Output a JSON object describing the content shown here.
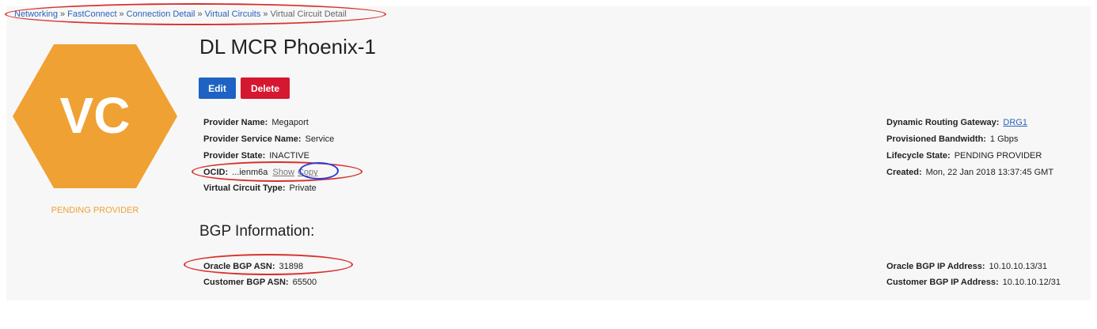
{
  "breadcrumb": {
    "items": [
      {
        "label": "Networking",
        "link": true
      },
      {
        "label": "FastConnect",
        "link": true
      },
      {
        "label": "Connection Detail",
        "link": true
      },
      {
        "label": "Virtual Circuits",
        "link": true
      },
      {
        "label": "Virtual Circuit Detail",
        "link": false
      }
    ],
    "separator": "»"
  },
  "resource_icon": {
    "abbr": "VC",
    "color": "#f0a133",
    "state": "PENDING PROVIDER"
  },
  "header": {
    "title": "DL MCR Phoenix-1",
    "edit_label": "Edit",
    "delete_label": "Delete"
  },
  "details_left": {
    "provider_name": {
      "label": "Provider Name:",
      "value": "Megaport"
    },
    "provider_service_name": {
      "label": "Provider Service Name:",
      "value": "Service"
    },
    "provider_state": {
      "label": "Provider State:",
      "value": "INACTIVE"
    },
    "ocid": {
      "label": "OCID:",
      "value": "...ienm6a",
      "show_label": "Show",
      "copy_label": "Copy"
    },
    "virtual_circuit_type": {
      "label": "Virtual Circuit Type:",
      "value": "Private"
    }
  },
  "details_right": {
    "drg": {
      "label": "Dynamic Routing Gateway:",
      "value": "DRG1"
    },
    "bandwidth": {
      "label": "Provisioned Bandwidth:",
      "value": "1 Gbps"
    },
    "lifecycle_state": {
      "label": "Lifecycle State:",
      "value": "PENDING PROVIDER"
    },
    "created": {
      "label": "Created:",
      "value": "Mon, 22 Jan 2018 13:37:45 GMT"
    }
  },
  "bgp": {
    "heading": "BGP Information:",
    "oracle_asn": {
      "label": "Oracle BGP ASN:",
      "value": "31898"
    },
    "customer_asn": {
      "label": "Customer BGP ASN:",
      "value": "65500"
    },
    "oracle_ip": {
      "label": "Oracle BGP IP Address:",
      "value": "10.10.10.13/31"
    },
    "customer_ip": {
      "label": "Customer BGP IP Address:",
      "value": "10.10.10.12/31"
    }
  },
  "colors": {
    "accent_blue": "#1e63c4",
    "danger_red": "#d5172f",
    "annotation_red": "#d9302c",
    "annotation_blue": "#2b3fd6"
  }
}
